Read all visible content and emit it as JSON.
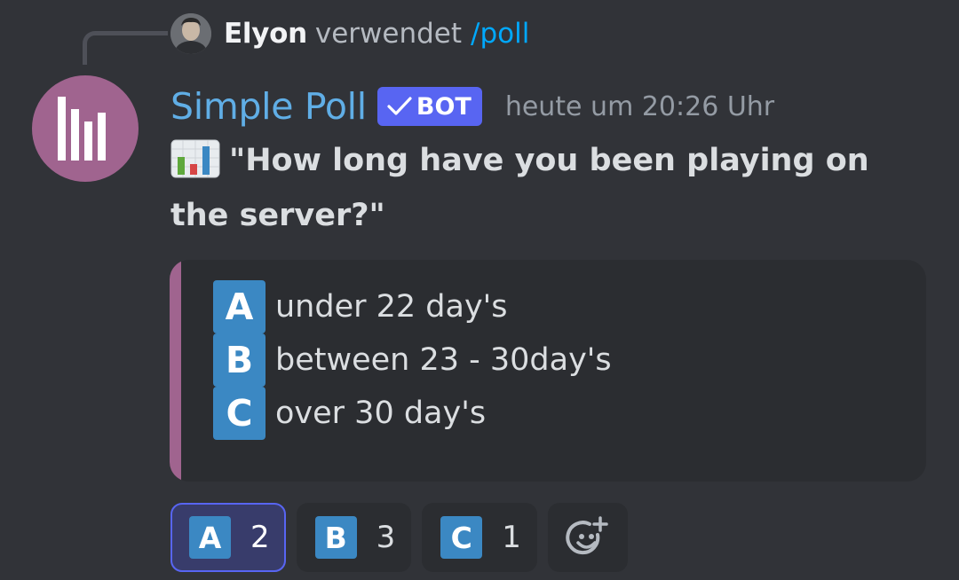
{
  "reply": {
    "username": "Elyon",
    "verb": "verwendet",
    "command": "/poll"
  },
  "message": {
    "author": "Simple Poll",
    "bot_tag": "BOT",
    "timestamp": "heute um 20:26 Uhr",
    "question": "\"How long have you been playing on the server?\"",
    "colors": {
      "author": "#60aee6",
      "accent": "#a0648f",
      "bot_tag": "#5865f2",
      "letter_box": "#3b88c3"
    }
  },
  "embed": {
    "options": [
      {
        "letter": "A",
        "text": "under 22 day's"
      },
      {
        "letter": "B",
        "text": "between 23 - 30day's"
      },
      {
        "letter": "C",
        "text": "over 30 day's"
      }
    ]
  },
  "reactions": [
    {
      "letter": "A",
      "count": "2",
      "selected": true
    },
    {
      "letter": "B",
      "count": "3",
      "selected": false
    },
    {
      "letter": "C",
      "count": "1",
      "selected": false
    }
  ],
  "icons": {
    "user_avatar": "user-avatar-icon",
    "bot_avatar": "bar-chart-logo-icon",
    "verified_check": "checkmark-icon",
    "question_emoji": "bar-chart-emoji-icon",
    "add_reaction": "add-reaction-icon"
  }
}
